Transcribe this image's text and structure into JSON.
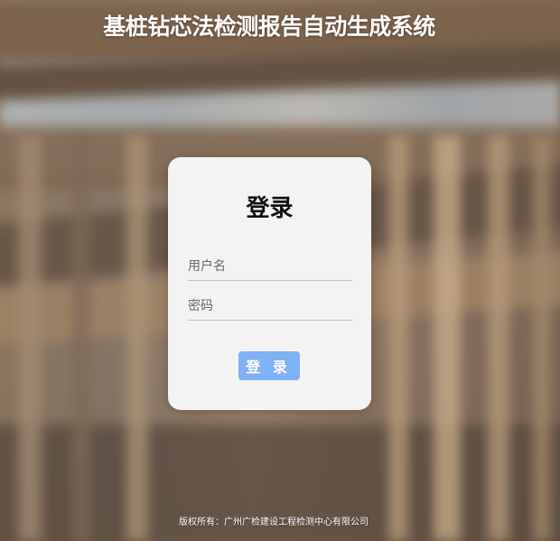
{
  "header": {
    "title": "基桩钻芯法检测报告自动生成系统"
  },
  "login_card": {
    "heading": "登录",
    "username_placeholder": "用户名",
    "username_value": "",
    "password_placeholder": "密码",
    "password_value": "",
    "submit_label": "登 录"
  },
  "footer": {
    "copyright": "版权所有：广州广检建设工程检测中心有限公司"
  },
  "colors": {
    "button_bg": "#7fb1f5",
    "card_bg": "#f3f3f3",
    "title_text": "#ffffff"
  }
}
